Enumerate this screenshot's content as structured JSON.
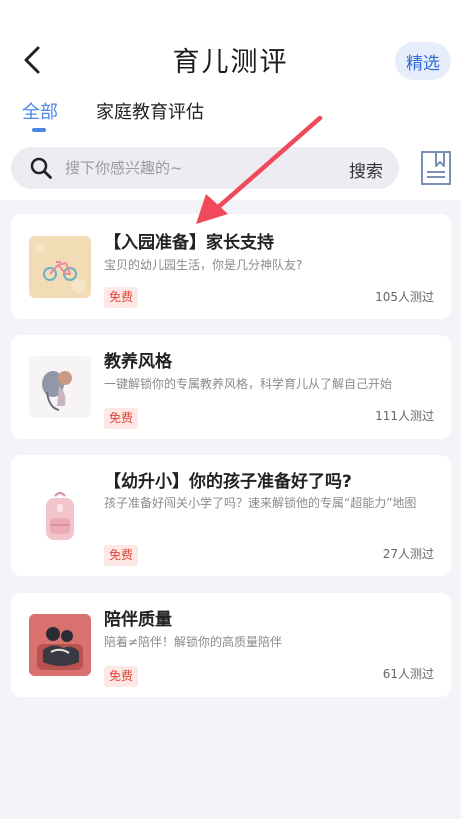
{
  "header": {
    "title": "育儿测评",
    "featured_label": "精选"
  },
  "tabs": [
    {
      "label": "全部",
      "active": true
    },
    {
      "label": "家庭教育评估",
      "active": false
    }
  ],
  "search": {
    "placeholder": "搜下你感兴趣的~",
    "button_label": "搜索"
  },
  "colors": {
    "accent": "#4a86e8",
    "free_badge": "#e0463a",
    "annotation_arrow": "#f04a5a"
  },
  "cards": [
    {
      "title": "【入园准备】家长支持",
      "desc": "宝贝的幼儿园生活，你是几分神队友?",
      "badge": "免费",
      "count": "105人测过",
      "thumb_icon": "bicycle-illustration"
    },
    {
      "title": "教养风格",
      "desc": "一键解锁你的专属教养风格，科学育儿从了解自己开始",
      "badge": "免费",
      "count": "111人测过",
      "thumb_icon": "parent-child-illustration"
    },
    {
      "title": "【幼升小】你的孩子准备好了吗?",
      "desc": "孩子准备好闯关小学了吗？速来解锁他的专属“超能力”地图",
      "badge": "免费",
      "count": "27人测过",
      "thumb_icon": "school-backpack-illustration"
    },
    {
      "title": "陪伴质量",
      "desc": "陪着≠陪伴！解锁你的高质量陪伴",
      "badge": "免费",
      "count": "61人测过",
      "thumb_icon": "family-hug-illustration"
    }
  ]
}
